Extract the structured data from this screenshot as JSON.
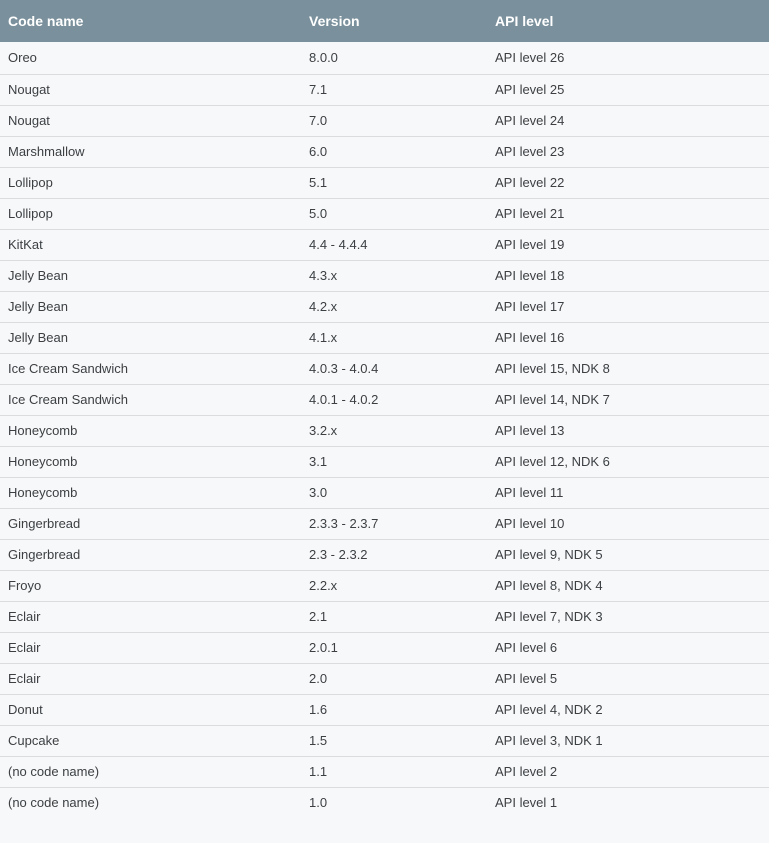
{
  "table": {
    "headers": [
      "Code name",
      "Version",
      "API level"
    ],
    "rows": [
      [
        "Oreo",
        "8.0.0",
        "API level 26"
      ],
      [
        "Nougat",
        "7.1",
        "API level 25"
      ],
      [
        "Nougat",
        "7.0",
        "API level 24"
      ],
      [
        "Marshmallow",
        "6.0",
        "API level 23"
      ],
      [
        "Lollipop",
        "5.1",
        "API level 22"
      ],
      [
        "Lollipop",
        "5.0",
        "API level 21"
      ],
      [
        "KitKat",
        "4.4 - 4.4.4",
        "API level 19"
      ],
      [
        "Jelly Bean",
        "4.3.x",
        "API level 18"
      ],
      [
        "Jelly Bean",
        "4.2.x",
        "API level 17"
      ],
      [
        "Jelly Bean",
        "4.1.x",
        "API level 16"
      ],
      [
        "Ice Cream Sandwich",
        "4.0.3 - 4.0.4",
        "API level 15, NDK 8"
      ],
      [
        "Ice Cream Sandwich",
        "4.0.1 - 4.0.2",
        "API level 14, NDK 7"
      ],
      [
        "Honeycomb",
        "3.2.x",
        "API level 13"
      ],
      [
        "Honeycomb",
        "3.1",
        "API level 12, NDK 6"
      ],
      [
        "Honeycomb",
        "3.0",
        "API level 11"
      ],
      [
        "Gingerbread",
        "2.3.3 - 2.3.7",
        "API level 10"
      ],
      [
        "Gingerbread",
        "2.3 - 2.3.2",
        "API level 9, NDK 5"
      ],
      [
        "Froyo",
        "2.2.x",
        "API level 8, NDK 4"
      ],
      [
        "Eclair",
        "2.1",
        "API level 7, NDK 3"
      ],
      [
        "Eclair",
        "2.0.1",
        "API level 6"
      ],
      [
        "Eclair",
        "2.0",
        "API level 5"
      ],
      [
        "Donut",
        "1.6",
        "API level 4, NDK 2"
      ],
      [
        "Cupcake",
        "1.5",
        "API level 3, NDK 1"
      ],
      [
        "(no code name)",
        "1.1",
        "API level 2"
      ],
      [
        "(no code name)",
        "1.0",
        "API level 1"
      ]
    ]
  },
  "colors": {
    "header_background": "#7a909c",
    "header_text": "#ffffff",
    "row_background": "#f7f8fa",
    "row_divider": "#dadce0",
    "cell_text": "#3c4043"
  }
}
